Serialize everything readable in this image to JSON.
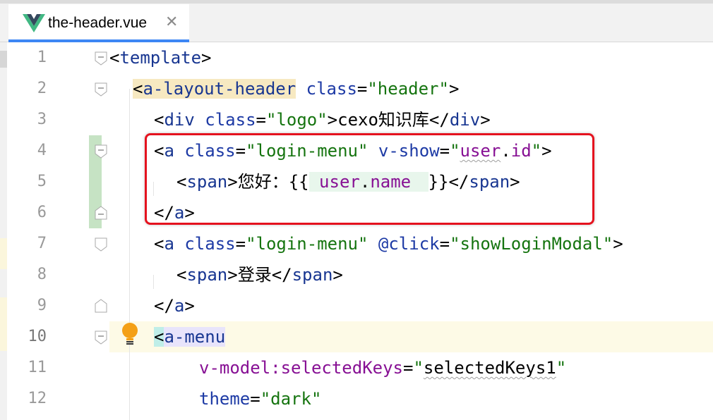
{
  "tab": {
    "icon": "vue-logo-icon",
    "file_name": "the-header.vue",
    "close_glyph": "✕"
  },
  "gutter": {
    "line_numbers": [
      "1",
      "2",
      "3",
      "4",
      "5",
      "6",
      "7",
      "8",
      "9",
      "10",
      "11",
      "12"
    ]
  },
  "code": {
    "l1": {
      "open": "<",
      "tag": "template",
      "close": ">"
    },
    "l2": {
      "open": "<",
      "tag": "a-layout-header",
      "sp": " ",
      "attr": "class",
      "eq": "=",
      "val": "\"header\"",
      "close": ">"
    },
    "l3": {
      "open": "<",
      "tag": "div",
      "sp": " ",
      "attr": "class",
      "eq": "=",
      "val": "\"logo\"",
      "gt": ">",
      "text": "cexo知识库",
      "end_open": "</",
      "end_tag": "div",
      "close": ">"
    },
    "l4": {
      "open": "<",
      "tag": "a",
      "sp": " ",
      "attr": "class",
      "eq": "=",
      "val": "\"login-menu\"",
      "sp2": " ",
      "attr2": "v-show",
      "eq2": "=",
      "q1": "\"",
      "obj": "user",
      "dot": ".",
      "field": "id",
      "q2": "\"",
      "close": ">"
    },
    "l5": {
      "open": "<",
      "tag": "span",
      "gt": ">",
      "text": "您好：{{",
      "obj": " user",
      "dot": ".",
      "field": "name ",
      "mustache_close": "}}",
      "end_open": "</",
      "end_tag": "span",
      "close": ">"
    },
    "l6": {
      "end_open": "</",
      "tag": "a",
      "close": ">"
    },
    "l7": {
      "open": "<",
      "tag": "a",
      "sp": " ",
      "attr": "class",
      "eq": "=",
      "val": "\"login-menu\"",
      "sp2": " ",
      "attr2": "@click",
      "eq2": "=",
      "val2": "\"showLoginModal\"",
      "close": ">"
    },
    "l8": {
      "open": "<",
      "tag": "span",
      "gt": ">",
      "text": "登录",
      "end_open": "</",
      "end_tag": "span",
      "close": ">"
    },
    "l9": {
      "end_open": "</",
      "tag": "a",
      "close": ">"
    },
    "l10": {
      "open": "<",
      "tag": "a-menu"
    },
    "l11": {
      "attr": "v-model:selectedKeys",
      "eq": "=",
      "val_q1": "\"",
      "val": "selectedKeys1",
      "val_q2": "\""
    },
    "l12": {
      "attr": "theme",
      "eq": "=",
      "val": "\"dark\""
    }
  },
  "colors": {
    "tag": "#183691",
    "attribute": "#1d3aa5",
    "string": "#15740f",
    "property": "#871094",
    "highlight_box": "#e5121e",
    "vcs_changed": "#c6e3c4",
    "current_line": "#fdfae6",
    "tab_underline": "#3d86f4"
  },
  "annotation": {
    "icon": "intention-bulb-icon"
  }
}
